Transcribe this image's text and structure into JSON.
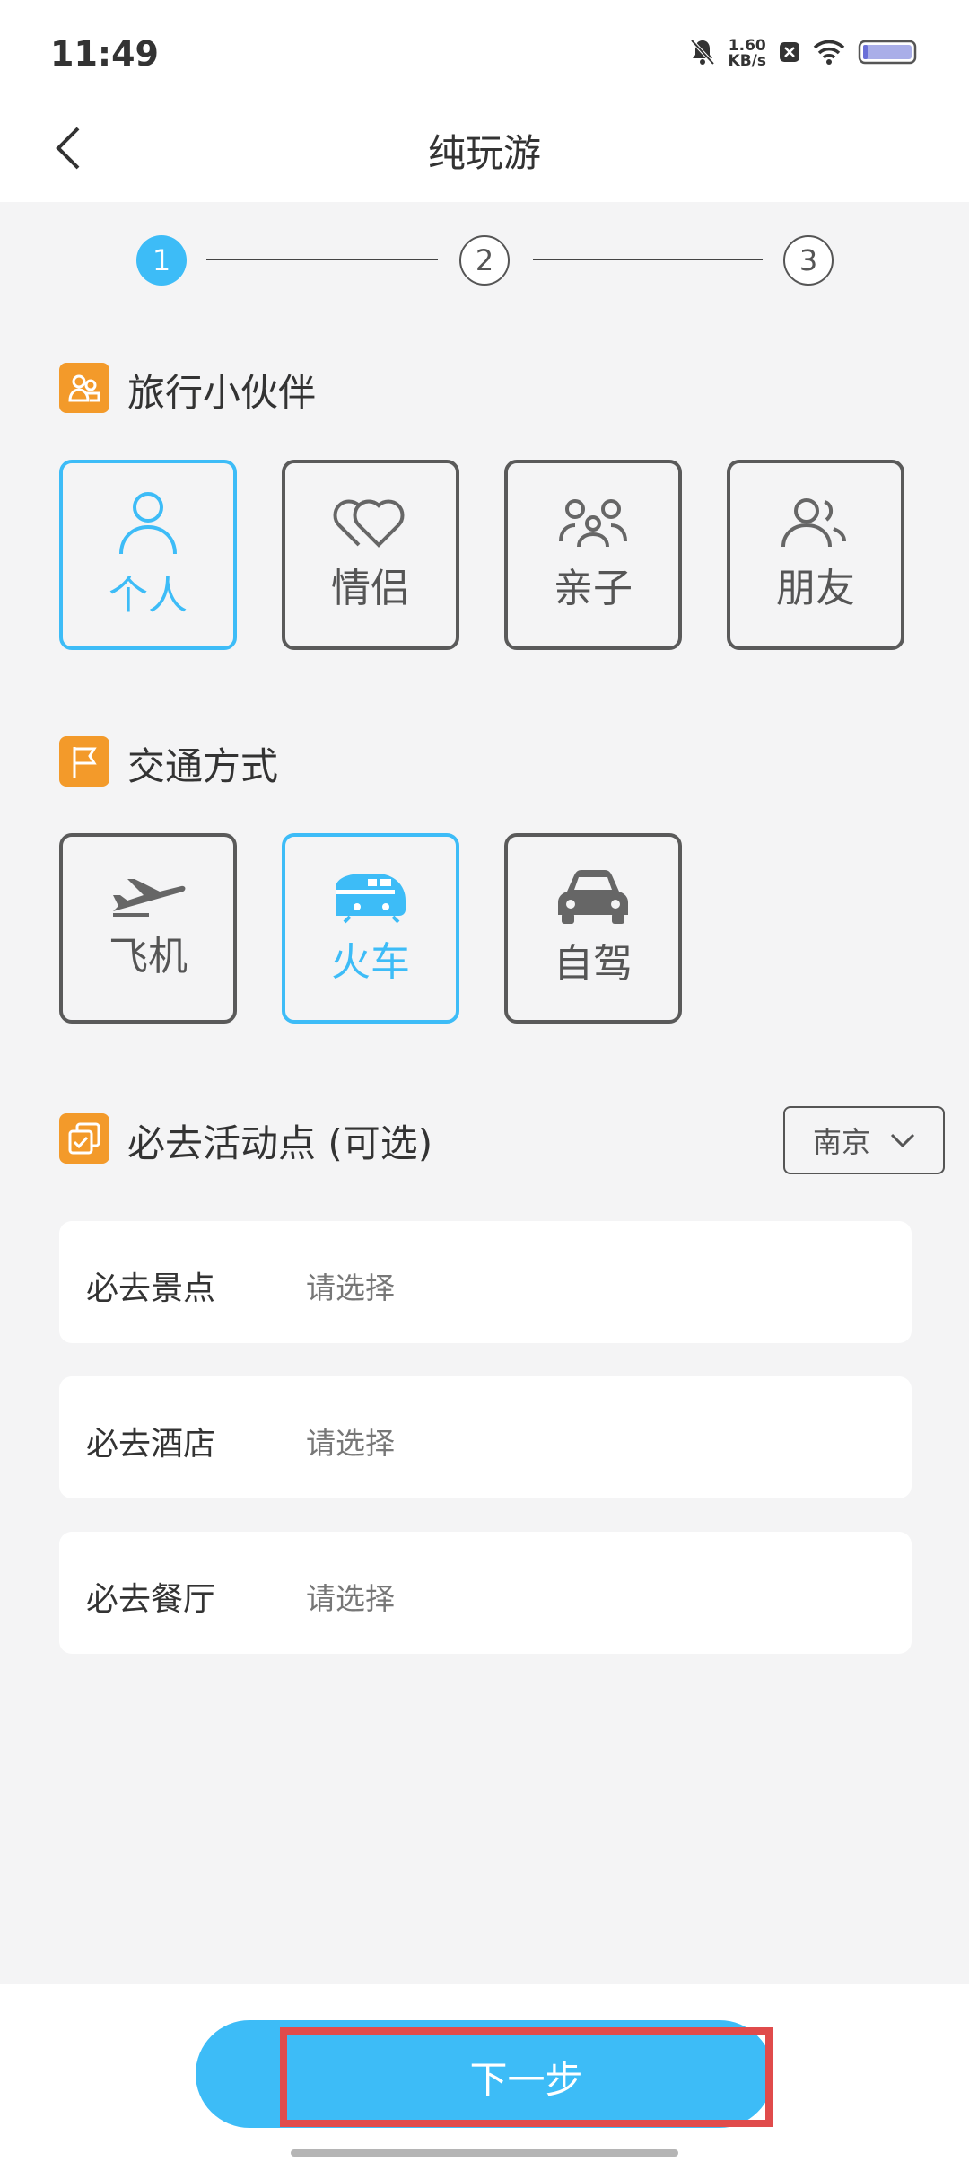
{
  "status_bar": {
    "time": "11:49",
    "net_speed_value": "1.60",
    "net_speed_unit": "KB/s",
    "icons": [
      "bell-muted-icon",
      "close-box-icon",
      "wifi-icon",
      "battery-icon"
    ]
  },
  "header": {
    "title": "纯玩游"
  },
  "stepper": {
    "steps": [
      "1",
      "2",
      "3"
    ],
    "active_index": 0
  },
  "companions": {
    "title": "旅行小伙伴",
    "options": [
      {
        "label": "个人",
        "icon": "person-icon",
        "selected": true
      },
      {
        "label": "情侣",
        "icon": "hearts-icon",
        "selected": false
      },
      {
        "label": "亲子",
        "icon": "family-icon",
        "selected": false
      },
      {
        "label": "朋友",
        "icon": "friends-icon",
        "selected": false
      }
    ]
  },
  "transport": {
    "title": "交通方式",
    "options": [
      {
        "label": "飞机",
        "icon": "airplane-icon",
        "selected": false
      },
      {
        "label": "火车",
        "icon": "train-icon",
        "selected": true
      },
      {
        "label": "自驾",
        "icon": "car-icon",
        "selected": false
      }
    ]
  },
  "must_go": {
    "title": "必去活动点 (可选)",
    "city": "南京",
    "rows": [
      {
        "label": "必去景点",
        "value": "请选择"
      },
      {
        "label": "必去酒店",
        "value": "请选择"
      },
      {
        "label": "必去餐厅",
        "value": "请选择"
      }
    ]
  },
  "footer": {
    "next_label": "下一步"
  },
  "colors": {
    "accent": "#3dbcf7",
    "orange": "#f39a2a",
    "highlight_border": "#e04b4b"
  }
}
